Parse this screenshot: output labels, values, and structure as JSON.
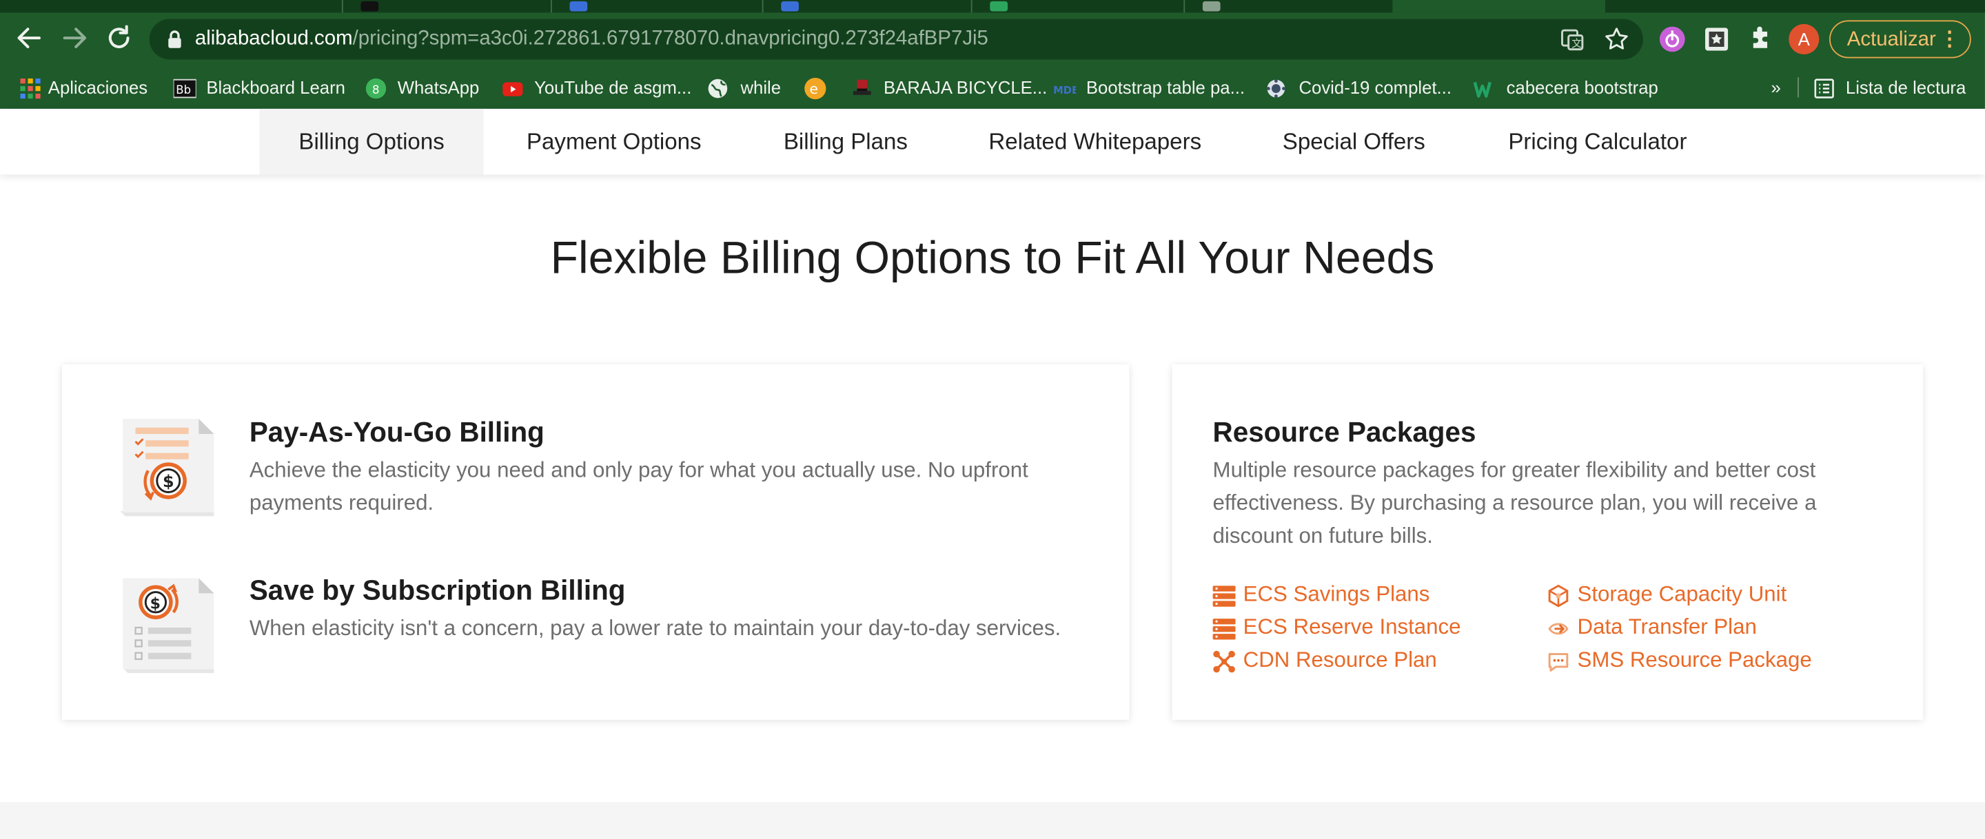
{
  "browser": {
    "url_host": "alibabacloud.com",
    "url_path": "/pricing?spm=a3c0i.272861.6791778070.dnavpricing0.273f24afBP7Ji5",
    "avatar_letter": "A",
    "update_label": "Actualizar",
    "bookmarks_overflow": "»",
    "bookmarks": [
      {
        "label": "Aplicaciones",
        "icon": "apps-grid-icon"
      },
      {
        "label": "Blackboard Learn",
        "icon": "blackboard-icon"
      },
      {
        "label": "WhatsApp",
        "icon": "whatsapp-icon"
      },
      {
        "label": "YouTube de asgm...",
        "icon": "youtube-icon"
      },
      {
        "label": "while",
        "icon": "globe-icon"
      },
      {
        "label": "",
        "icon": "coin-icon"
      },
      {
        "label": "BARAJA BICYCLE...",
        "icon": "hat-icon"
      },
      {
        "label": "Bootstrap table pa...",
        "icon": "mdb-icon"
      },
      {
        "label": "Covid-19 complet...",
        "icon": "covid-icon"
      },
      {
        "label": "cabecera bootstrap",
        "icon": "w-logo-icon"
      }
    ],
    "reading_list": "Lista de lectura"
  },
  "subnav": {
    "tabs": [
      {
        "label": "Billing Options",
        "active": true
      },
      {
        "label": "Payment Options"
      },
      {
        "label": "Billing Plans"
      },
      {
        "label": "Related Whitepapers"
      },
      {
        "label": "Special Offers"
      },
      {
        "label": "Pricing Calculator"
      }
    ]
  },
  "main": {
    "headline": "Flexible Billing Options to Fit All Your Needs",
    "billing_card": {
      "items": [
        {
          "title": "Pay-As-You-Go Billing",
          "desc_line1": "Achieve the elasticity you need and only pay for what you actually use. No upfront",
          "desc_line2": "payments required.",
          "icon": "payg-invoice-icon"
        },
        {
          "title": "Save by Subscription Billing",
          "desc_line1": "When elasticity isn't a concern, pay a lower rate to maintain your day-to-day services.",
          "desc_line2": "",
          "icon": "subscription-invoice-icon"
        }
      ]
    },
    "resource_card": {
      "title": "Resource Packages",
      "desc_line1": "Multiple resource packages for greater flexibility and better cost",
      "desc_line2": "effectiveness. By purchasing a resource plan, you will receive a",
      "desc_line3": "discount on future bills.",
      "packages": [
        {
          "label": "ECS Savings Plans",
          "icon": "server-stack-icon"
        },
        {
          "label": "ECS Reserve Instance",
          "icon": "server-stack-icon"
        },
        {
          "label": "CDN Resource Plan",
          "icon": "cdn-network-icon"
        },
        {
          "label": "Storage Capacity Unit",
          "icon": "storage-cube-icon"
        },
        {
          "label": "Data Transfer Plan",
          "icon": "data-transfer-icon"
        },
        {
          "label": "SMS Resource Package",
          "icon": "sms-chat-icon"
        }
      ]
    }
  },
  "colors": {
    "chrome": "#1f5a2a",
    "accent": "#e86a28",
    "update_border": "#e6a64a"
  }
}
